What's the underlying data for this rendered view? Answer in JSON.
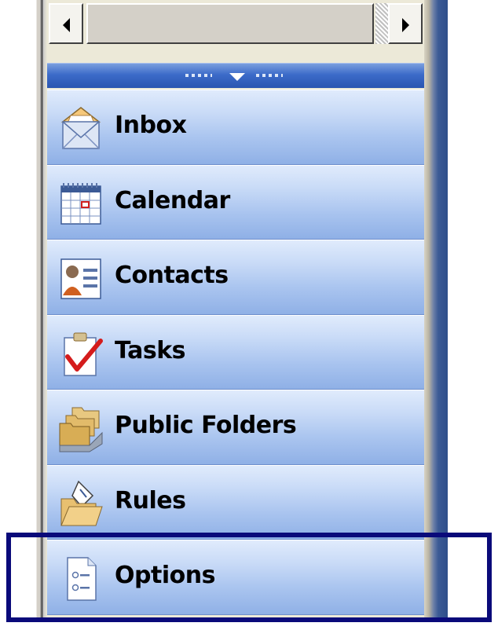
{
  "navigation": {
    "items": [
      {
        "label": "Inbox",
        "icon": "envelope-icon"
      },
      {
        "label": "Calendar",
        "icon": "calendar-icon"
      },
      {
        "label": "Contacts",
        "icon": "contact-card-icon"
      },
      {
        "label": "Tasks",
        "icon": "clipboard-check-icon"
      },
      {
        "label": "Public Folders",
        "icon": "folders-icon"
      },
      {
        "label": "Rules",
        "icon": "folder-rules-icon"
      },
      {
        "label": "Options",
        "icon": "options-document-icon"
      }
    ],
    "selected_label": "Options"
  },
  "colors": {
    "splitter_blue": "#3c6bc9",
    "button_light": "#e0ebfc",
    "button_dark": "#8fb0e6",
    "selection_border": "#0a0a7a"
  }
}
